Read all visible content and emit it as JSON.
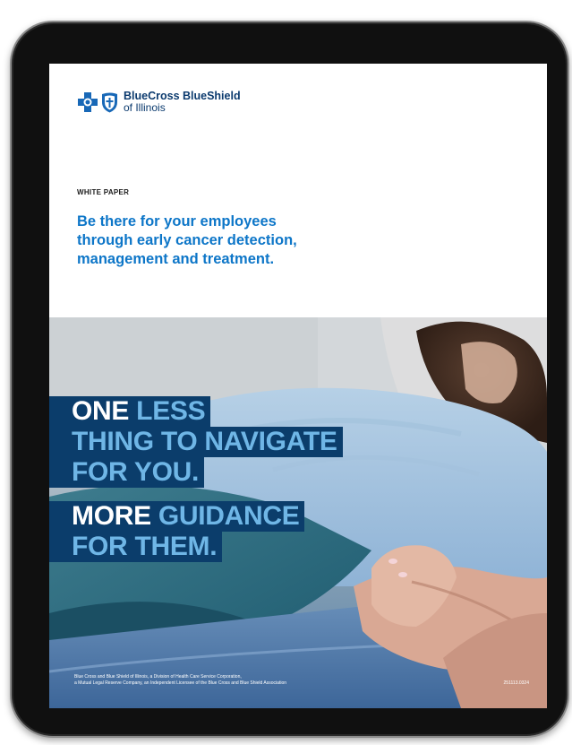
{
  "logo": {
    "brand_line": "BlueCross BlueShield",
    "sub_line": "of Illinois"
  },
  "document": {
    "eyebrow": "WHITE PAPER",
    "headline_lines": [
      "Be there for your employees",
      "through early cancer detection,",
      "management and treatment."
    ]
  },
  "hero": {
    "line1_white": "ONE",
    "line1_blue": "LESS",
    "line2": "THING TO NAVIGATE",
    "line3": "FOR YOU.",
    "line4_white": "MORE",
    "line4_blue": "GUIDANCE",
    "line5": "FOR THEM."
  },
  "footer": {
    "line1": "Blue Cross and Blue Shield of Illinois, a Division of Health Care Service Corporation,",
    "line2": "a Mutual Legal Reserve Company, an Independent Licensee of the Blue Cross and Blue Shield Association",
    "code": "251113.0324"
  },
  "colors": {
    "brand_navy": "#0b3d6b",
    "headline_blue": "#0d76c8",
    "accent_light_blue": "#6fb6e6"
  }
}
